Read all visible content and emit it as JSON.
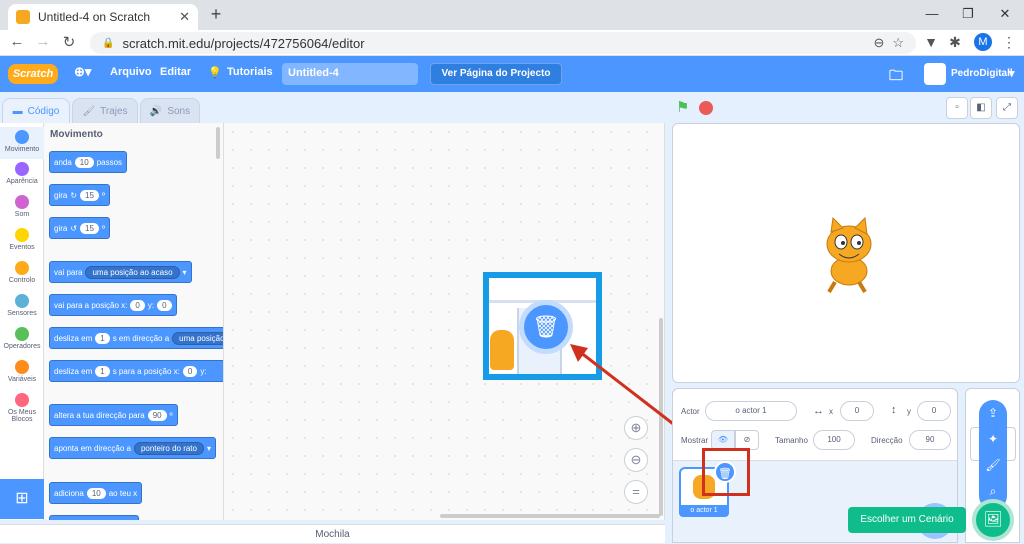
{
  "browser": {
    "tab_title": "Untitled-4 on Scratch",
    "tab_close": "✕",
    "new_tab": "+",
    "url": "scratch.mit.edu/projects/472756064/editor",
    "profile_initial": "M",
    "window_controls": [
      "—",
      "❐",
      "✕"
    ]
  },
  "menubar": {
    "logo": "Scratch",
    "file": "Arquivo",
    "edit": "Editar",
    "tutorials": "Tutoriais",
    "project_title": "Untitled-4",
    "see_project": "Ver Página do Projecto",
    "username": "PedroDigitall"
  },
  "tabs": {
    "code": "Código",
    "costumes": "Trajes",
    "sounds": "Sons"
  },
  "categories": [
    {
      "label": "Movimento",
      "color": "#4c97ff"
    },
    {
      "label": "Aparência",
      "color": "#9966ff"
    },
    {
      "label": "Som",
      "color": "#cf63cf"
    },
    {
      "label": "Eventos",
      "color": "#ffd500"
    },
    {
      "label": "Controlo",
      "color": "#ffab19"
    },
    {
      "label": "Sensores",
      "color": "#5cb1d6"
    },
    {
      "label": "Operadores",
      "color": "#59c059"
    },
    {
      "label": "Variáveis",
      "color": "#ff8c1a"
    },
    {
      "label": "Os Meus Blocos",
      "color": "#ff6680"
    }
  ],
  "palette": {
    "heading": "Movimento",
    "b1": {
      "a": "anda",
      "v": "10",
      "b": "passos"
    },
    "b2": {
      "a": "gira",
      "v": "15",
      "b": "º"
    },
    "b3": {
      "a": "gira",
      "v": "15",
      "b": "º"
    },
    "b4": {
      "a": "vai para",
      "dd": "uma posição ao acaso"
    },
    "b5": {
      "a": "vai para a posição x:",
      "x": "0",
      "y_lbl": "y:",
      "y": "0"
    },
    "b6": {
      "a": "desliza em",
      "v": "1",
      "b": "s em direcção a",
      "dd": "uma posição"
    },
    "b7": {
      "a": "desliza em",
      "v": "1",
      "b": "s para a posição x:",
      "x": "0",
      "y_lbl": "y:"
    },
    "b8": {
      "a": "altera a tua direcção para",
      "v": "90",
      "b": "º"
    },
    "b9": {
      "a": "aponta em direcção a",
      "dd": "ponteiro do rato"
    },
    "b10": {
      "a": "adiciona",
      "v": "10",
      "b": "ao teu x"
    }
  },
  "backpack": "Mochila",
  "sprite_info": {
    "actor_label": "Actor",
    "actor_value": "o actor 1",
    "x_label": "x",
    "x_value": "0",
    "y_label": "y",
    "y_value": "0",
    "show_label": "Mostrar",
    "size_label": "Tamanho",
    "size_value": "100",
    "direction_label": "Direcção",
    "direction_value": "90"
  },
  "sprite_tile_name": "o actor 1",
  "tooltip": "Escolher um Cenário"
}
